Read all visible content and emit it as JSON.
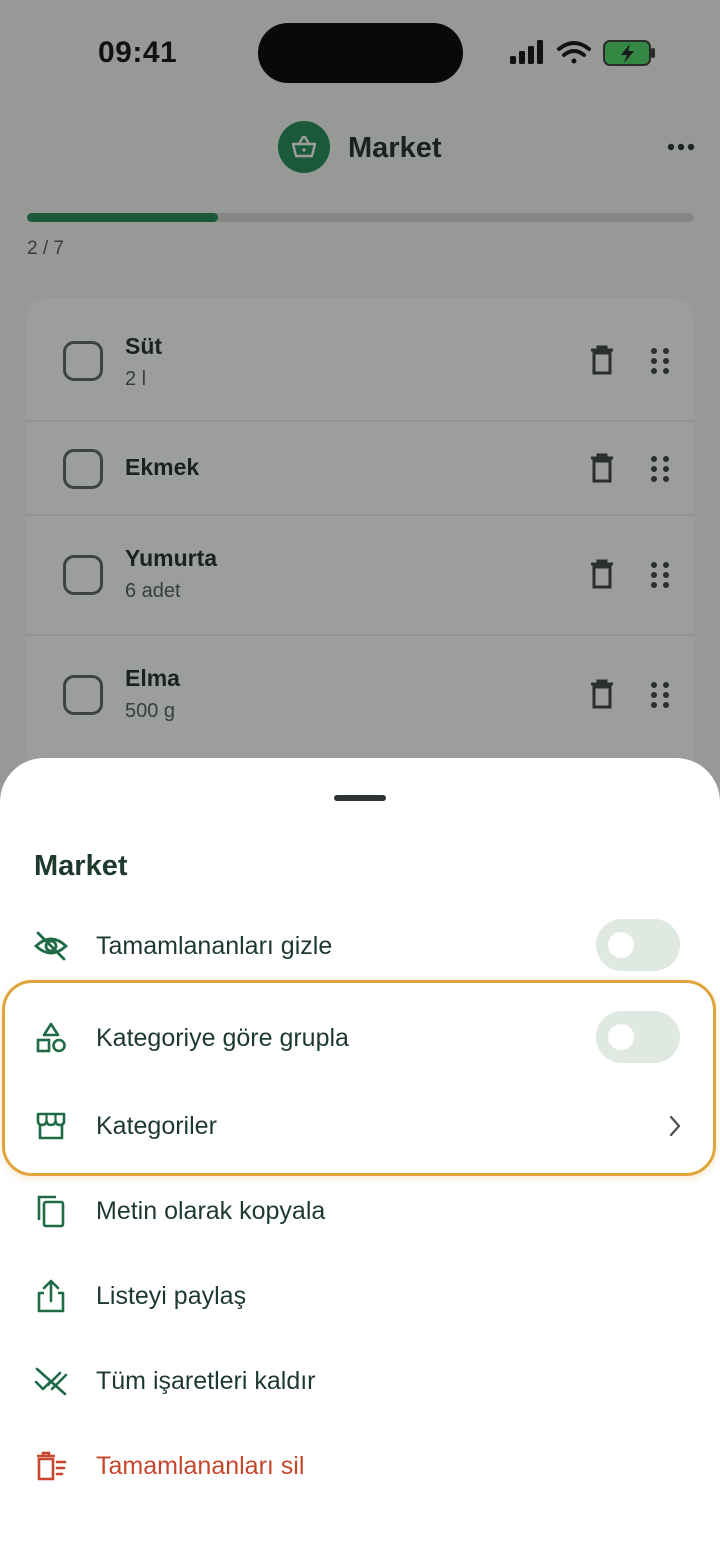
{
  "status_bar": {
    "time": "09:41"
  },
  "header": {
    "title": "Market",
    "logo_icon": "basket-icon",
    "more_icon": "more-horizontal-icon"
  },
  "progress": {
    "text": "2 / 7",
    "completed": 2,
    "total": 7,
    "accent": "#1f8a55"
  },
  "items": [
    {
      "name": "Süt",
      "qty": "2 l"
    },
    {
      "name": "Ekmek",
      "qty": ""
    },
    {
      "name": "Yumurta",
      "qty": "6 adet"
    },
    {
      "name": "Elma",
      "qty": "500 g"
    }
  ],
  "sheet": {
    "title": "Market",
    "options": [
      {
        "label": "Tamamlananları gizle",
        "icon": "eye-off-icon",
        "control": "toggle",
        "on": false
      },
      {
        "label": "Kategoriye göre grupla",
        "icon": "shapes-icon",
        "control": "toggle",
        "on": false
      },
      {
        "label": "Kategoriler",
        "icon": "store-icon",
        "control": "chevron"
      },
      {
        "label": "Metin olarak kopyala",
        "icon": "copy-icon",
        "control": "none"
      },
      {
        "label": "Listeyi paylaş",
        "icon": "share-icon",
        "control": "none"
      },
      {
        "label": "Tüm işaretleri kaldır",
        "icon": "uncheck-all-icon",
        "control": "none"
      },
      {
        "label": "Tamamlananları sil",
        "icon": "delete-list-icon",
        "control": "none",
        "danger": true
      }
    ]
  },
  "colors": {
    "brand": "#1f8a55",
    "text": "#1e3a2c",
    "danger": "#c6472c",
    "highlight": "#e0a53a"
  }
}
